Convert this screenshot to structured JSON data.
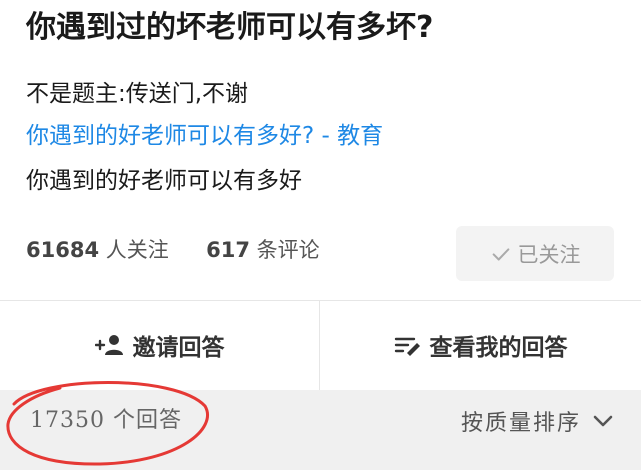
{
  "question": {
    "title": "你遇到过的坏老师可以有多坏?"
  },
  "description": {
    "line1": "不是题主:传送门,不谢",
    "link": "你遇到的好老师可以有多好? - 教育",
    "line3": "你遇到的好老师可以有多好"
  },
  "stats": {
    "followers_count": "61684",
    "followers_label": "人关注",
    "comments_count": "617",
    "comments_label": "条评论"
  },
  "follow_button": {
    "label": "已关注",
    "icon": "check-icon"
  },
  "actions": {
    "invite_label": "邀请回答",
    "invite_icon": "add-user-icon",
    "mine_label": "查看我的回答",
    "mine_icon": "edit-list-icon"
  },
  "answers": {
    "count_text": "17350 个回答",
    "sort_label": "按质量排序",
    "sort_icon": "chevron-down-icon"
  },
  "colors": {
    "link": "#1e88e5",
    "annotation": "#e53935",
    "bar_background": "#f0f0f0"
  }
}
